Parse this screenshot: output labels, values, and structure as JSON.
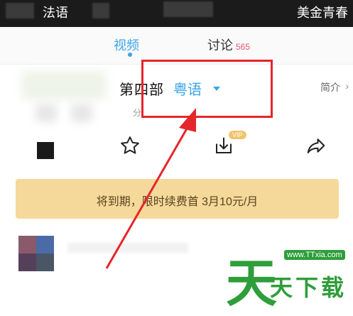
{
  "status_bar": {
    "left_label": "法语",
    "right_label": "美金青春"
  },
  "tabs": [
    {
      "label": "视频",
      "active": true
    },
    {
      "label": "讨论",
      "count": "565"
    }
  ],
  "episode": {
    "title": "第四部",
    "language": "粤语",
    "intro_label": "简介",
    "chevron": "›",
    "sub_text": "分"
  },
  "actions": {
    "icons": [
      "star-icon",
      "download-icon",
      "share-icon"
    ],
    "vip_badge": "VIP"
  },
  "banner": {
    "text": "将到期，限时续费首 3月10元/月"
  },
  "watermark": {
    "big": "天",
    "site": "天下载",
    "url": "www.TTxia.com"
  },
  "colors": {
    "accent": "#3aa5e6",
    "highlight_red": "#e5262b",
    "banner_bg": "#f5d99a",
    "watermark_green": "#2e9e3a"
  }
}
